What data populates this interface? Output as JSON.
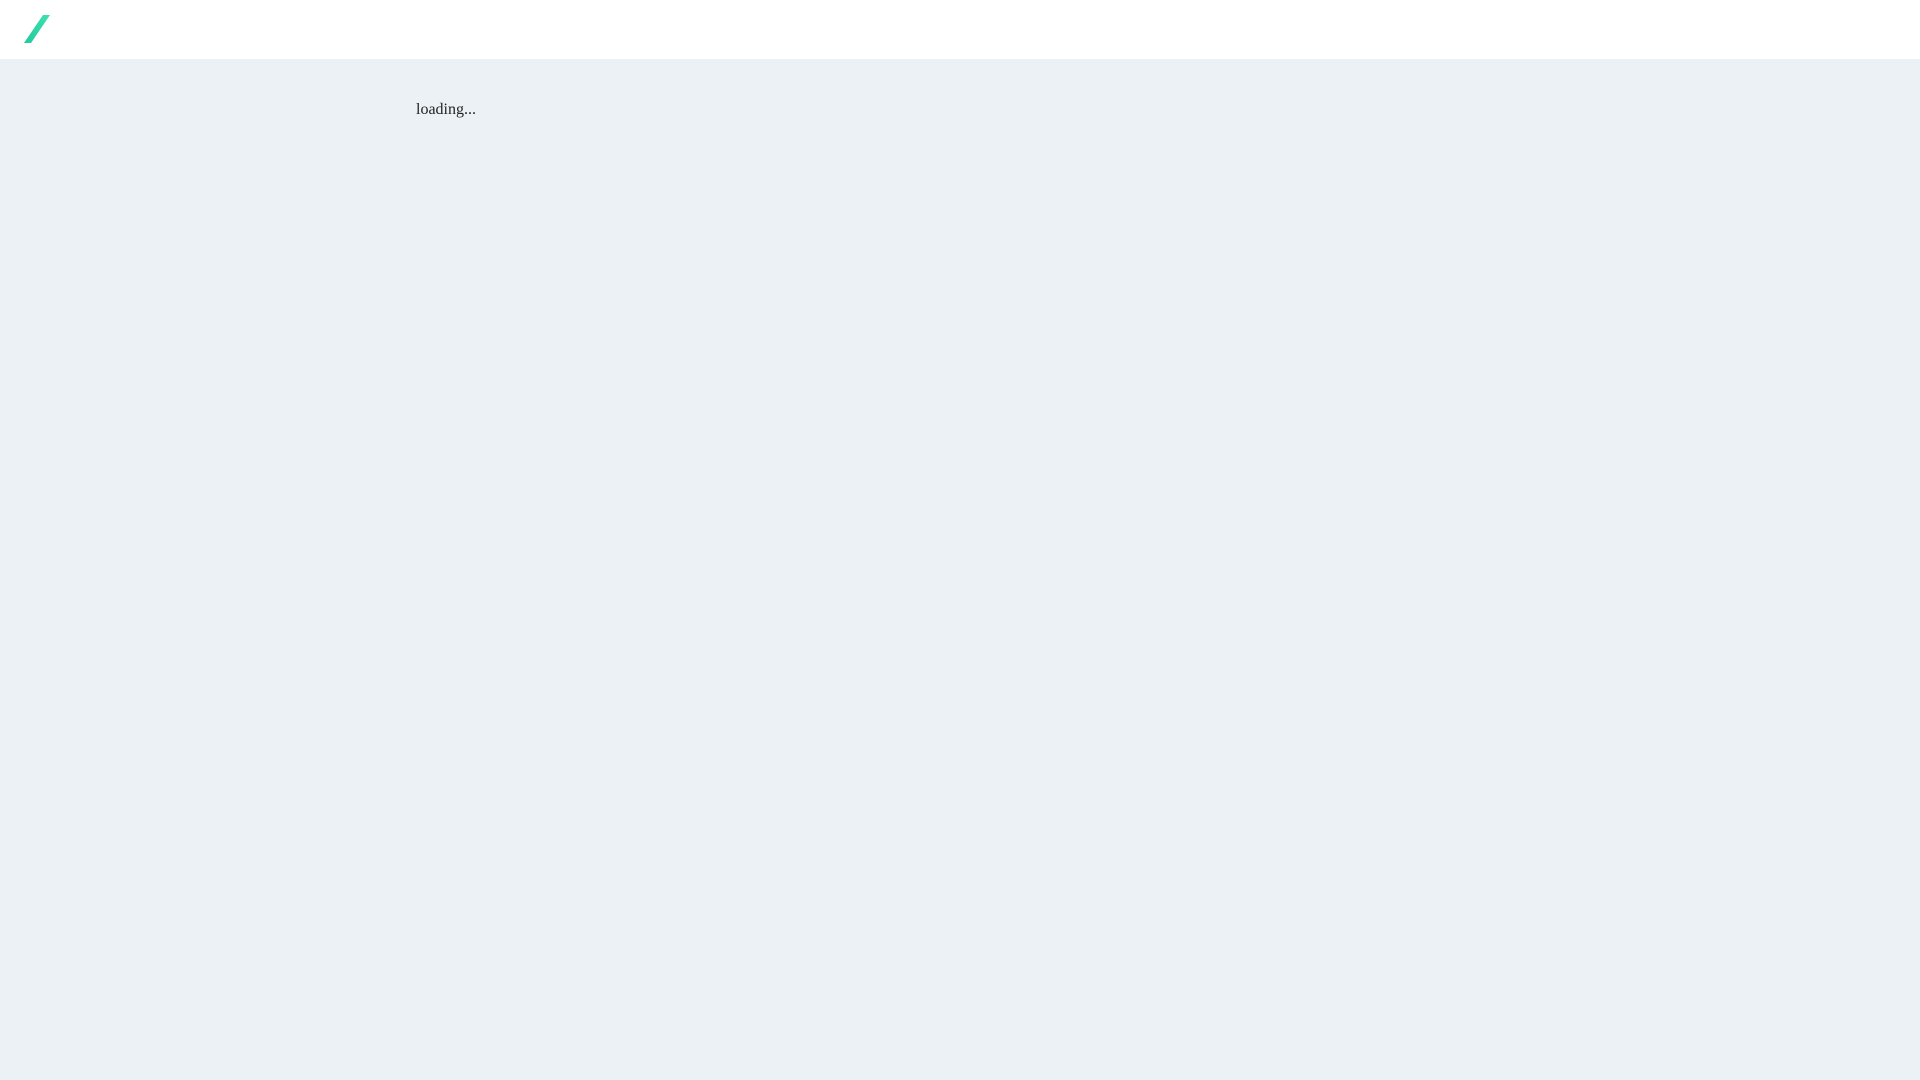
{
  "header": {
    "logo_icon": "slash-logo-icon",
    "logo_color": "#2fd6a8"
  },
  "main": {
    "loading_text": "loading..."
  }
}
